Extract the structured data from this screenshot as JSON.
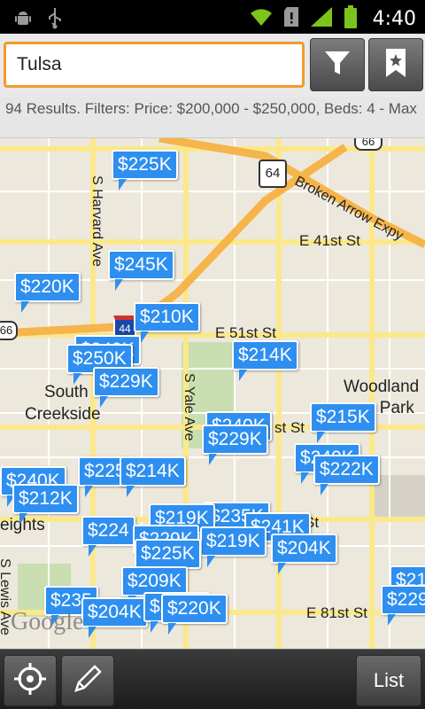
{
  "status_bar": {
    "icons": [
      "android-debug-icon",
      "usb-icon",
      "wifi-icon",
      "sd-card-icon",
      "signal-icon",
      "battery-icon"
    ],
    "time": "4:40"
  },
  "search": {
    "value": "Tulsa",
    "filter_icon": "filter-funnel-icon",
    "saved_icon": "bookmark-star-icon"
  },
  "results": {
    "text": "94 Results. Filters: Price: $200,000 - $250,000, Beds: 4 - Max"
  },
  "map": {
    "labels": {
      "broken_arrow": "Broken Arrow Expy",
      "e41": "E 41st St",
      "e51": "E 51st St",
      "sharvard": "S Harvard Ave",
      "syale": "S Yale Ave",
      "south": "South",
      "creekside": "Creekside",
      "woodland": "Woodland",
      "vpark": "y Park",
      "e81": "E 81st St",
      "eights": "eights",
      "slewis": "S Lewis Ave",
      "st_right": "st St",
      "st_mid": "St",
      "hwy64": "64",
      "hwy66": "66",
      "hwy66b": "66",
      "i44": "44",
      "google": "Google"
    },
    "pins": [
      "$225K",
      "$245K",
      "$220K",
      "$210K",
      "$250K",
      "$229K",
      "$214K",
      "$229K",
      "$215K",
      "$222K",
      "$240K",
      "$212K",
      "$225",
      "$214K",
      "$224",
      "$219K",
      "$219K",
      "$241K",
      "$204K",
      "$225K",
      "$209K",
      "$235",
      "$204K",
      "$220K",
      "$229",
      "$21",
      "$240K",
      "$235K",
      "$229K",
      "$241K",
      "$240K"
    ]
  },
  "bottom_bar": {
    "locate_icon": "crosshair-locate-icon",
    "draw_icon": "pencil-draw-icon",
    "list_label": "List"
  }
}
